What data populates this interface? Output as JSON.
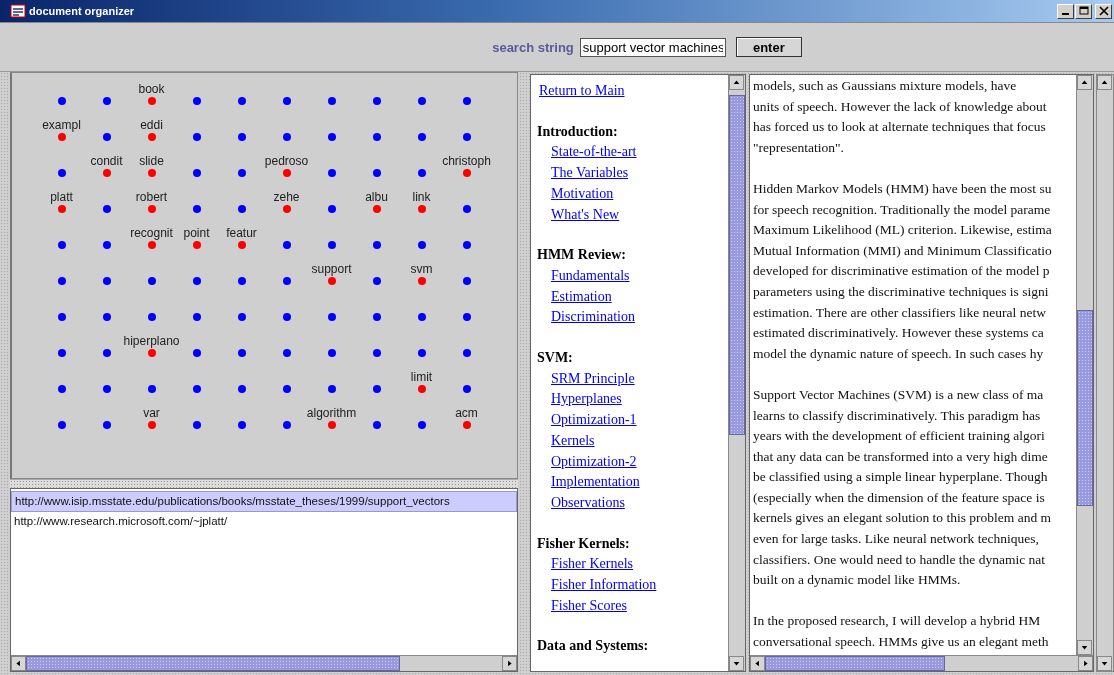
{
  "window": {
    "title": "document organizer"
  },
  "search": {
    "label": "search string",
    "value": "support vector machines",
    "button": "enter"
  },
  "term_map": {
    "rows": [
      [
        {
          "color": "#0000ff"
        },
        {
          "color": "#0000ff"
        },
        {
          "color": "#ff0000",
          "label": "book"
        },
        {
          "color": "#0000ff"
        },
        {
          "color": "#0000ff"
        },
        {
          "color": "#0000ff"
        },
        {
          "color": "#0000ff"
        },
        {
          "color": "#0000ff"
        },
        {
          "color": "#0000ff"
        },
        {
          "color": "#0000ff"
        }
      ],
      [
        {
          "color": "#ff0000",
          "label": "exampl"
        },
        {
          "color": "#0000ff"
        },
        {
          "color": "#ff0000",
          "label": "eddi"
        },
        {
          "color": "#0000ff"
        },
        {
          "color": "#0000ff"
        },
        {
          "color": "#0000ff"
        },
        {
          "color": "#0000ff"
        },
        {
          "color": "#0000ff"
        },
        {
          "color": "#0000ff"
        },
        {
          "color": "#0000ff"
        }
      ],
      [
        {
          "color": "#0000ff"
        },
        {
          "color": "#ff0000",
          "label": "condit"
        },
        {
          "color": "#ff0000",
          "label": "slide"
        },
        {
          "color": "#0000ff"
        },
        {
          "color": "#0000ff"
        },
        {
          "color": "#ff0000",
          "label": "pedroso"
        },
        {
          "color": "#0000ff"
        },
        {
          "color": "#0000ff"
        },
        {
          "color": "#0000ff"
        },
        {
          "color": "#ff0000",
          "label": "christoph"
        }
      ],
      [
        {
          "color": "#ff0000",
          "label": "platt"
        },
        {
          "color": "#0000ff"
        },
        {
          "color": "#ff0000",
          "label": "robert"
        },
        {
          "color": "#0000ff"
        },
        {
          "color": "#0000ff"
        },
        {
          "color": "#ff0000",
          "label": "zehe"
        },
        {
          "color": "#0000ff"
        },
        {
          "color": "#ff0000",
          "label": "albu"
        },
        {
          "color": "#ff0000",
          "label": "link"
        },
        {
          "color": "#0000ff"
        }
      ],
      [
        {
          "color": "#0000ff"
        },
        {
          "color": "#0000ff"
        },
        {
          "color": "#ff0000",
          "label": "recognit"
        },
        {
          "color": "#ff0000",
          "label": "point"
        },
        {
          "color": "#ff0000",
          "label": "featur"
        },
        {
          "color": "#0000ff"
        },
        {
          "color": "#0000ff"
        },
        {
          "color": "#0000ff"
        },
        {
          "color": "#0000ff"
        },
        {
          "color": "#0000ff"
        }
      ],
      [
        {
          "color": "#0000ff"
        },
        {
          "color": "#0000ff"
        },
        {
          "color": "#0000ff"
        },
        {
          "color": "#0000ff"
        },
        {
          "color": "#0000ff"
        },
        {
          "color": "#0000ff"
        },
        {
          "color": "#ff0000",
          "label": "support"
        },
        {
          "color": "#0000ff"
        },
        {
          "color": "#ff0000",
          "label": "svm"
        },
        {
          "color": "#0000ff"
        }
      ],
      [
        {
          "color": "#0000ff"
        },
        {
          "color": "#0000ff"
        },
        {
          "color": "#0000ff"
        },
        {
          "color": "#0000ff"
        },
        {
          "color": "#0000ff"
        },
        {
          "color": "#0000ff"
        },
        {
          "color": "#0000ff"
        },
        {
          "color": "#0000ff"
        },
        {
          "color": "#0000ff"
        },
        {
          "color": "#0000ff"
        }
      ],
      [
        {
          "color": "#0000ff"
        },
        {
          "color": "#0000ff"
        },
        {
          "color": "#ff0000",
          "label": "hiperplano"
        },
        {
          "color": "#0000ff"
        },
        {
          "color": "#0000ff"
        },
        {
          "color": "#0000ff"
        },
        {
          "color": "#0000ff"
        },
        {
          "color": "#0000ff"
        },
        {
          "color": "#0000ff"
        },
        {
          "color": "#0000ff"
        }
      ],
      [
        {
          "color": "#0000ff"
        },
        {
          "color": "#0000ff"
        },
        {
          "color": "#0000ff"
        },
        {
          "color": "#0000ff"
        },
        {
          "color": "#0000ff"
        },
        {
          "color": "#0000ff"
        },
        {
          "color": "#0000ff"
        },
        {
          "color": "#0000ff"
        },
        {
          "color": "#ff0000",
          "label": "limit"
        },
        {
          "color": "#0000ff"
        }
      ],
      [
        {
          "color": "#0000ff"
        },
        {
          "color": "#0000ff"
        },
        {
          "color": "#ff0000",
          "label": "var"
        },
        {
          "color": "#0000ff"
        },
        {
          "color": "#0000ff"
        },
        {
          "color": "#0000ff"
        },
        {
          "color": "#ff0000",
          "label": "algorithm"
        },
        {
          "color": "#0000ff"
        },
        {
          "color": "#0000ff"
        },
        {
          "color": "#ff0000",
          "label": "acm"
        }
      ]
    ]
  },
  "results": [
    {
      "url": "http://www.isip.msstate.edu/publications/books/msstate_theses/1999/support_vectors",
      "selected": true
    },
    {
      "url": "http://www.research.microsoft.com/~jplatt/",
      "selected": false
    }
  ],
  "contents": {
    "return_link": "Return to Main",
    "sections": [
      {
        "heading": "Introduction:",
        "links": [
          "State-of-the-art",
          "The Variables",
          "Motivation",
          "What's New"
        ]
      },
      {
        "heading": "HMM Review:",
        "links": [
          "Fundamentals",
          "Estimation",
          "Discrimination"
        ]
      },
      {
        "heading": "SVM:",
        "links": [
          "SRM Principle",
          "Hyperplanes",
          "Optimization-1",
          "Kernels",
          "Optimization-2",
          "Implementation",
          "Observations"
        ]
      },
      {
        "heading": "Fisher Kernels:",
        "links": [
          "Fisher Kernels",
          "Fisher Information",
          "Fisher Scores"
        ]
      },
      {
        "heading": "Data and Systems:"
      }
    ]
  },
  "document": {
    "paragraphs": [
      [
        "models, such as Gaussians mixture models, have",
        "units of speech. However the lack of knowledge about",
        "has forced us to look at alternate techniques that focus",
        "\"representation\"."
      ],
      [
        "Hidden Markov Models (HMM) have been the most su",
        "for speech recognition.  Traditionally the model parame",
        "Maximum Likelihood (ML) criterion. Likewise, estima",
        "Mutual Information (MMI) and Minimum Classificatio",
        "developed for discriminative estimation of the model p",
        "parameters using the discriminative techniques is signi",
        "estimation. There are other classifiers like neural netw",
        "estimated discriminatively. However these systems ca",
        "model the dynamic nature of speech. In such cases hy"
      ],
      [
        "Support Vector Machines (SVM) is a new class of ma",
        "learns to classify discriminatively. This paradigm has",
        "years with the development of efficient training algori",
        "that any data can be transformed into a very high dime",
        "be classified using a simple linear hyperplane. Though",
        "(especially when the dimension of the feature space is",
        "kernels gives an elegant solution to this problem and m",
        "even for large tasks. Like neural network techniques,",
        "classifiers. One would need to handle the dynamic nat",
        "built on a dynamic model like HMMs."
      ],
      [
        "In the proposed research, I will develop a hybrid HM",
        "conversational speech. HMMs give us an elegant meth"
      ]
    ]
  }
}
